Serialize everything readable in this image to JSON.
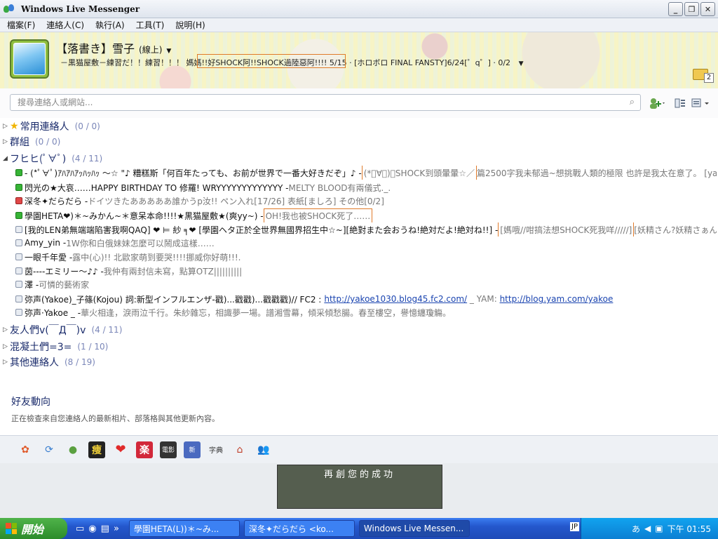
{
  "window": {
    "title": "Windows Live Messenger",
    "minimize": "_",
    "restore": "❐",
    "close": "✕"
  },
  "menu": [
    "檔案(F)",
    "連絡人(C)",
    "執行(A)",
    "工具(T)",
    "說明(H)"
  ],
  "profile": {
    "name": "【落書き】雪子",
    "status": "(線上)",
    "psm": "－黒猫屋敷－練習だ！！練習！！！ 媽媽!!好SHOCK阿!!SHOCK過陸惡阿!!!! 5/15 · [ホロボロ FINAL FANSTY]6/24[゜q゜] · 0/2",
    "mail_count": "2"
  },
  "search": {
    "placeholder": "搜尋連絡人或網站..."
  },
  "groups": [
    {
      "name": "常用連絡人",
      "count": "(0 / 0)"
    },
    {
      "name": "群組",
      "count": "(0 / 0)"
    },
    {
      "name": "フヒヒ(ﾟ∀ﾟ)",
      "count": "(4 / 11)"
    },
    {
      "name": "友人們v(￣Д￣)v",
      "count": "(4 / 11)"
    },
    {
      "name": "混凝土們=3=",
      "count": "(1 / 10)"
    },
    {
      "name": "其他連絡人",
      "count": "(8 / 19)"
    }
  ],
  "contacts": [
    {
      "name": "- (*ﾟ∀ﾟ)ｱﾊｱﾊｱｯﾊｯﾊｯ ～☆ \"♪ 糟糕斯「何百年たっても、お前が世界で一番大好きだぞ」♪ -",
      "psm_hl": "(*ﾟ∀ﾟ)／SHOCK到頭暈暈☆／",
      "psm": "篇2500字我未郁過~想挑戰人類的極限 也許是我太在意了。 [ya..."
    },
    {
      "name": "閃光の★大哀……HAPPY BIRTHDAY TO 修羅! WRYYYYYYYYYYYYY -",
      "psm": "MELTY BLOOD有兩儀式._."
    },
    {
      "name": "深冬✦だらだら -",
      "psm": "ドイツきたあああああ誰かうp汝!! ペン入れ[17/26] 表紙[ましろ] その他[0/2]"
    },
    {
      "name": "學園HETA❤)＊~みかん~＊意呆本命!!!!★黒猫屋敷★(爽yy~) -",
      "psm_hl": "OH!我也被SHOCK死了……"
    },
    {
      "name": "[我的LEN弟無端端陷害我啊QAQ] ❤ ⊨ 紗 ╕❤ [學園ヘタ正於全世界無國界招生中☆~][絶對また会おうね!絶対だよ!絶対ね!!] -",
      "psm_hl": "[媽哦//咁搞法想SHOCK死我咩/////]",
      "psm": "[妖精さん?妖精さぁん~(..."
    },
    {
      "name": "Amy_yin -",
      "psm": "1W你和白俄妹妹怎麼可以鬧成這樣……"
    },
    {
      "name": "一眼千年愛 -",
      "psm": "露中(心)!! 北歐家萌到要哭!!!!挪威你好萌!!!."
    },
    {
      "name": "茵----エミリー～♪♪ -",
      "psm": "我仲有兩封信未寫，點算OTZ||||||||||"
    },
    {
      "name": "澤 -",
      "psm": "可憐的藝術家"
    },
    {
      "name": "弥声(Yakoe)_子篠(Kojou) 詞:新型インフルエンザ-戳)...戳戳)...戳戳戳)// FC2 :",
      "link1": "http://yakoe1030.blog45.fc2.com/",
      "mid": " _ YAM: ",
      "link2": "http://blog.yam.com/yakoe"
    },
    {
      "name": "弥声·Yakoe _ -",
      "psm": "華火相逢，淚雨泣千行。朱紗雜忘，相識夢一場。譜湘雪幕，傾采傾愁腸。春至樓空，譽憶纏瓊觴。"
    }
  ],
  "whatsnew": {
    "title": "好友動向",
    "subtitle": "正在檢查來自您連絡人的最新相片、部落格與其他更新內容。"
  },
  "ad": {
    "text": "再創您的成功"
  },
  "taskbar": {
    "start": "開始",
    "tasks": [
      "學園HETA(L))＊~み...",
      "深冬✦だらだら <ko...",
      "Windows Live Messen..."
    ],
    "lang": "JP",
    "time": "下午 01:55"
  }
}
